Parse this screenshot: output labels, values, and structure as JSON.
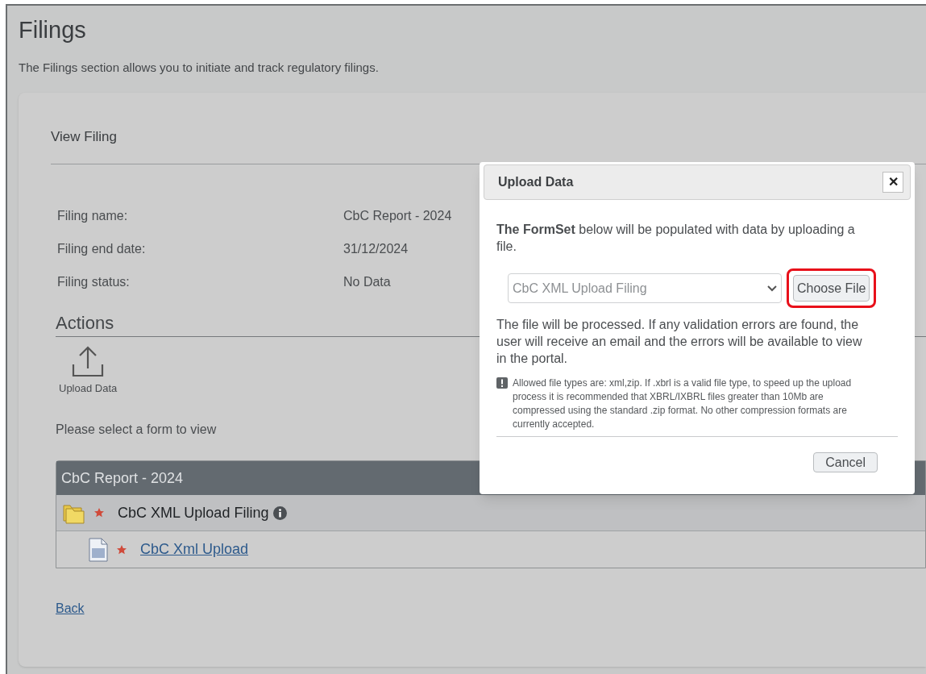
{
  "page": {
    "title": "Filings",
    "description": "The Filings section allows you to initiate and track regulatory filings."
  },
  "card": {
    "title": "View Filing",
    "fields": [
      {
        "label": "Filing name:",
        "value": "CbC Report - 2024"
      },
      {
        "label": "Filing end date:",
        "value": "31/12/2024"
      },
      {
        "label": "Filing status:",
        "value": "No Data"
      }
    ],
    "actions": {
      "title": "Actions",
      "items": [
        {
          "label": "Upload Data",
          "kind": "upload"
        }
      ]
    },
    "prompt": "Please select a form to view",
    "tree": {
      "title": "CbC Report - 2024",
      "items": [
        {
          "label": "CbC XML Upload Filing",
          "kind": "folder",
          "required": true,
          "info": true,
          "link": false,
          "children": [
            {
              "label": "CbC Xml Upload",
              "kind": "document",
              "required": true,
              "info": false,
              "link": true
            }
          ]
        }
      ]
    },
    "back_link": "Back"
  },
  "dialog": {
    "title": "Upload Data",
    "close": "✕",
    "intro": "**The FormSet** below will be populated with data by uploading a file.",
    "select": {
      "value": "CbC XML Upload Filing"
    },
    "choose_button": {
      "label": "Choose File",
      "highlighted": true
    },
    "processing_text": "The file will be processed. If any validation errors are found, the user will receive an email and the errors will be available to view in the portal.",
    "note": "Allowed file types are: xml,zip. If .xbrl is a valid file type, to speed up the upload process it is recommended that XBRL/IXBRL files greater than 10Mb are compressed using the standard .zip format. No other compression formats are currently accepted.",
    "cancel_button": "Cancel"
  }
}
